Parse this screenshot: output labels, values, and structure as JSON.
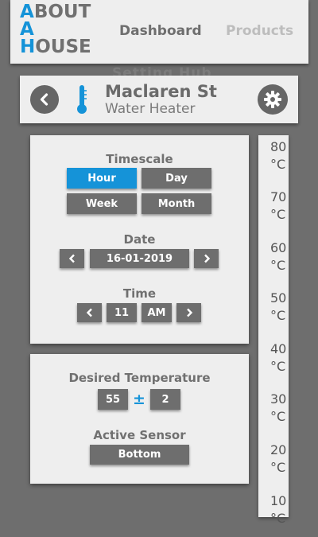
{
  "header": {
    "logo": {
      "l1_first": "A",
      "l1_rest": "BOUT",
      "l2_first": "A",
      "l3_first": "H",
      "l3_rest": "OUSE"
    },
    "nav": {
      "dashboard": "Dashboard",
      "products": "Products"
    },
    "ghost_text": "Setting Hub"
  },
  "device": {
    "name": "Maclaren St",
    "type": "Water Heater",
    "icons": {
      "back": "chevron-left-icon",
      "device": "thermometer-icon",
      "settings": "gear-icon"
    }
  },
  "timescale": {
    "title": "Timescale",
    "options": [
      "Hour",
      "Day",
      "Week",
      "Month"
    ],
    "selected": "Hour"
  },
  "date": {
    "title": "Date",
    "value": "16-01-2019",
    "prev": "chevron-left-icon",
    "next": "chevron-right-icon"
  },
  "time": {
    "title": "Time",
    "hour": "11",
    "period": "AM"
  },
  "desired": {
    "title": "Desired Temperature",
    "value": "55",
    "symbol": "±",
    "tolerance": "2"
  },
  "sensor": {
    "title": "Active Sensor",
    "value": "Bottom"
  },
  "scale": {
    "ticks": [
      {
        "value": "80",
        "unit": "°C"
      },
      {
        "value": "70",
        "unit": "°C"
      },
      {
        "value": "60",
        "unit": "°C"
      },
      {
        "value": "50",
        "unit": "°C"
      },
      {
        "value": "40",
        "unit": "°C"
      },
      {
        "value": "30",
        "unit": "°C"
      },
      {
        "value": "20",
        "unit": "°C"
      },
      {
        "value": "10",
        "unit": "°C"
      }
    ]
  },
  "colors": {
    "accent": "#1593d8",
    "panel": "#eeeeee",
    "button": "#6e6e6e",
    "background": "#6e6e6e"
  }
}
